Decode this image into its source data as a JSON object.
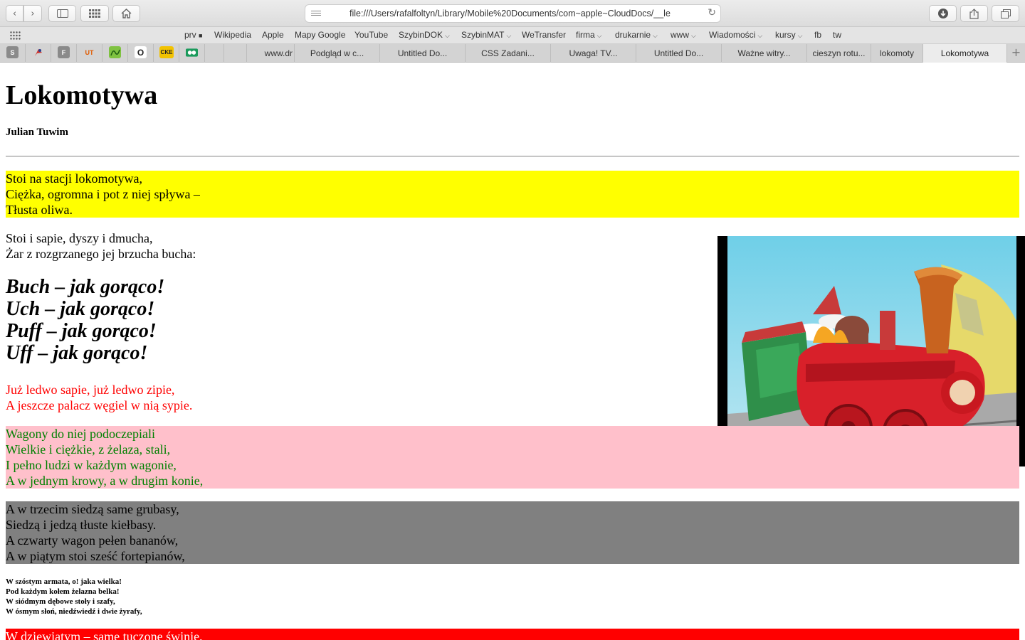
{
  "browser": {
    "url": "file:///Users/rafalfoltyn/Library/Mobile%20Documents/com~apple~CloudDocs/__le",
    "bookmarks": [
      {
        "label": "prv",
        "suffix": "■"
      },
      {
        "label": "Wikipedia"
      },
      {
        "label": "Apple"
      },
      {
        "label": "Mapy Google"
      },
      {
        "label": "YouTube"
      },
      {
        "label": "SzybinDOK",
        "dropdown": true
      },
      {
        "label": "SzybinMAT",
        "dropdown": true
      },
      {
        "label": "WeTransfer"
      },
      {
        "label": "firma",
        "dropdown": true
      },
      {
        "label": "drukarnie",
        "dropdown": true
      },
      {
        "label": "www",
        "dropdown": true
      },
      {
        "label": "Wiadomości",
        "dropdown": true
      },
      {
        "label": "kursy",
        "dropdown": true
      },
      {
        "label": "fb"
      },
      {
        "label": "tw"
      }
    ],
    "pinned": [
      "S",
      "",
      "F",
      "UT",
      "",
      "O",
      "CKE",
      ""
    ],
    "tabs": [
      "www.dr",
      "Podgląd w c...",
      "Untitled Do...",
      "CSS Zadani...",
      "Uwaga! TV...",
      "Untitled Do...",
      "Ważne witry...",
      "cieszyn rotu...",
      "lokomoty",
      "Lokomotywa"
    ],
    "active_tab": "Lokomotywa"
  },
  "page": {
    "title": "Lokomotywa",
    "author": "Julian Tuwim",
    "stanza1": [
      "Stoi na stacji lokomotywa,",
      "Ciężka, ogromna i pot z niej spływa –",
      "Tłusta oliwa."
    ],
    "stanza2": [
      "Stoi i sapie, dyszy i dmucha,",
      "Żar z rozgrzanego jej brzucha bucha:"
    ],
    "stanza3": [
      "Buch – jak gorąco!",
      "Uch – jak gorąco!",
      "Puff – jak gorąco!",
      "Uff – jak gorąco!"
    ],
    "stanza4": [
      "Już ledwo sapie, już ledwo zipie,",
      "A jeszcze palacz węgiel w nią sypie."
    ],
    "stanza5": [
      "Wagony do niej podoczepiali",
      "Wielkie i ciężkie, z żelaza, stali,",
      "I pełno ludzi w każdym wagonie,",
      "A w jednym krowy, a w drugim konie,"
    ],
    "stanza6": [
      "A w trzecim siedzą same grubasy,",
      "Siedzą i jedzą tłuste kiełbasy.",
      "A czwarty wagon pełen bananów,",
      "A w piątym stoi sześć fortepianów,"
    ],
    "stanza7": [
      "W szóstym armata, o! jaka wielka!",
      "Pod każdym kołem żelazna belka!",
      "W siódmym dębowe stoły i szafy,",
      "W ósmym słoń, niedźwiedź i dwie żyrafy,"
    ],
    "stanza8": [
      "W dziewiątym – same tuczone świnie,"
    ]
  },
  "colors": {
    "stanza1_bg": "#ffff00",
    "stanza4_text": "#ff0000",
    "stanza5_bg": "#ffc0cb",
    "stanza5_text": "#008000",
    "stanza6_bg": "#808080",
    "stanza8_bg": "#ff0000"
  },
  "icons": [
    "chevron-left-icon",
    "chevron-right-icon",
    "sidebar-icon",
    "grid-icon",
    "home-icon",
    "reader-icon",
    "reload-icon",
    "download-icon",
    "share-icon",
    "tabs-icon",
    "plus-icon"
  ]
}
